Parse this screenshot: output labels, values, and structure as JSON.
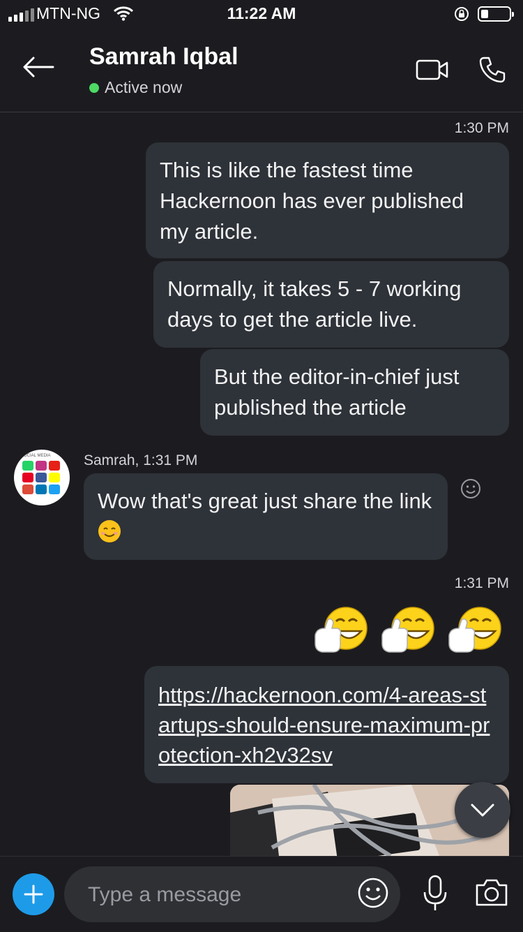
{
  "status_bar": {
    "carrier": "MTN-NG",
    "time": "11:22 AM"
  },
  "header": {
    "contact_name": "Samrah Iqbal",
    "presence": "Active now"
  },
  "messages": {
    "ts1": "1:30 PM",
    "out1": "This is like the fastest time Hackernoon has ever published my article.",
    "out2": "Normally, it takes 5 - 7 working days to get the article live.",
    "out3": "But the editor-in-chief just published the article",
    "sender_line": "Samrah, 1:31 PM",
    "in1": "Wow that's great just share the link",
    "ts2": "1:31 PM",
    "link": "https://hackernoon.com/4-areas-startups-should-ensure-maximum-protection-xh2v32sv"
  },
  "composer": {
    "placeholder": "Type a message"
  },
  "colors": {
    "background": "#1c1c20",
    "bubble": "#2e3239",
    "accent": "#1e9be8",
    "presence": "#4cd964"
  },
  "icons": [
    "back-arrow-icon",
    "video-call-icon",
    "phone-icon",
    "smiley-react-icon",
    "thumbs-up-emoji-icon",
    "chevron-down-icon",
    "plus-icon",
    "emoji-icon",
    "microphone-icon",
    "camera-icon"
  ]
}
